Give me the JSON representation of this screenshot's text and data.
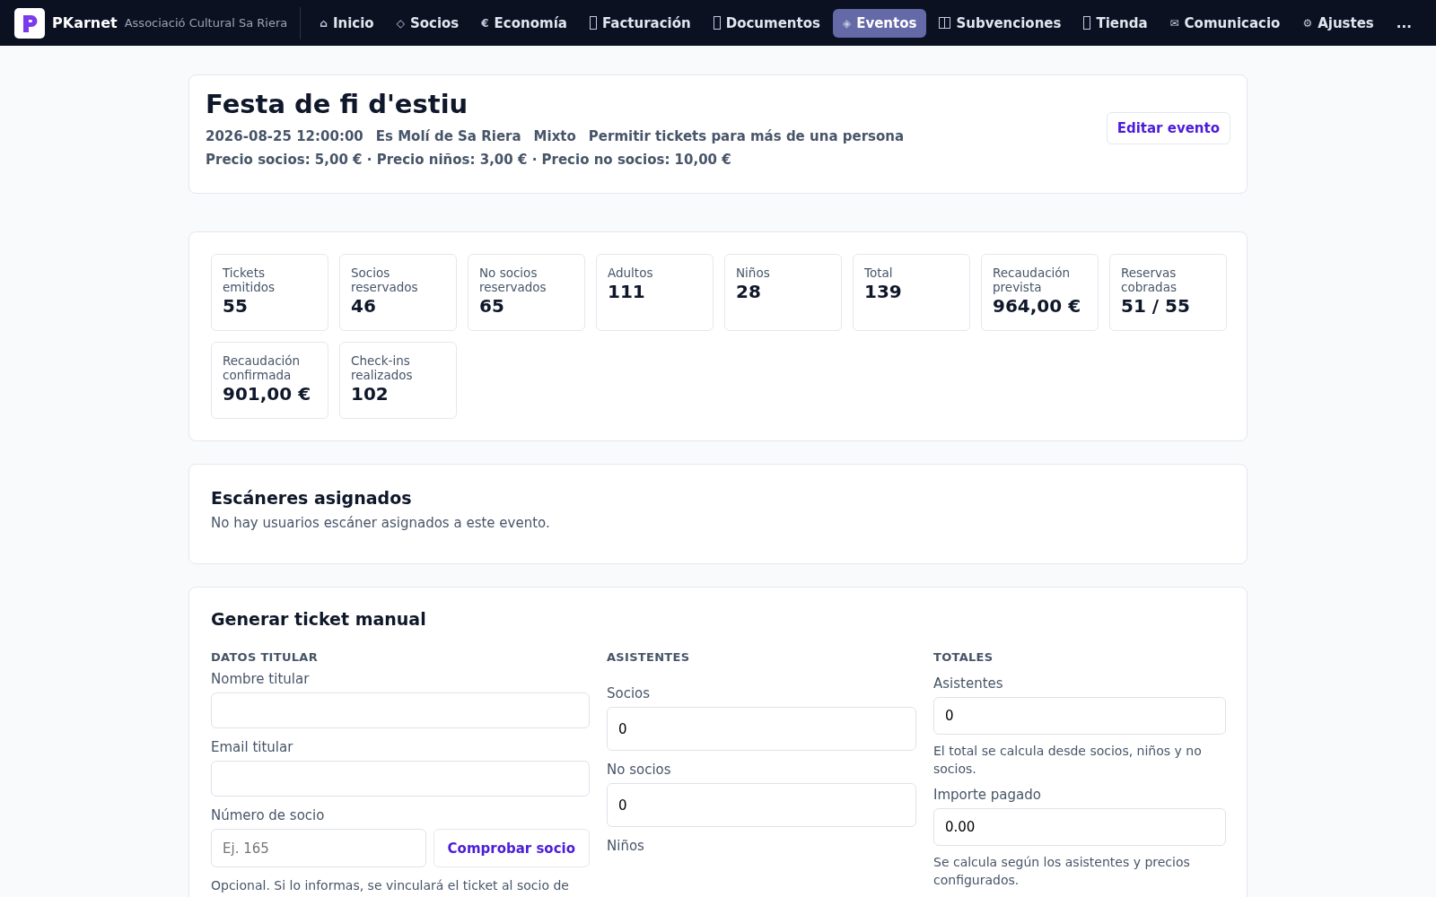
{
  "brand": {
    "name": "PKarnet",
    "subtitle": "Associació Cultural Sa Riera"
  },
  "nav": [
    {
      "label": "Inicio",
      "icon": "⌂",
      "selected": false
    },
    {
      "label": "Socios",
      "icon": "◇",
      "selected": false
    },
    {
      "label": "Economía",
      "icon": "€",
      "selected": false
    },
    {
      "label": "Facturación",
      "kind": "box",
      "selected": false
    },
    {
      "label": "Documentos",
      "kind": "box",
      "selected": false
    },
    {
      "label": "Eventos",
      "icon": "◈",
      "selected": true
    },
    {
      "label": "Subvenciones",
      "kind": "split",
      "selected": false
    },
    {
      "label": "Tienda",
      "kind": "box",
      "selected": false
    },
    {
      "label": "Comunicacio",
      "icon": "✉",
      "selected": false
    },
    {
      "label": "Ajustes",
      "icon": "⚙",
      "selected": false
    }
  ],
  "nav_more": "...",
  "event": {
    "title": "Festa de fi d'estiu",
    "meta": [
      "2026-08-25 12:00:00",
      "Es Molí de Sa Riera",
      "Mixto",
      "Permitir tickets para más de una persona"
    ],
    "prices": "Precio socios: 5,00 € · Precio niños: 3,00 € · Precio no socios: 10,00 €",
    "edit_button": "Editar evento"
  },
  "stats": [
    {
      "label": "Tickets emitidos",
      "value": "55"
    },
    {
      "label": "Socios reservados",
      "value": "46"
    },
    {
      "label": "No socios reservados",
      "value": "65"
    },
    {
      "label": "Adultos",
      "value": "111"
    },
    {
      "label": "Niños",
      "value": "28"
    },
    {
      "label": "Total",
      "value": "139"
    },
    {
      "label": "Recaudación prevista",
      "value": "964,00 €"
    },
    {
      "label": "Reservas cobradas",
      "value": "51 / 55"
    },
    {
      "label": "Recaudación confirmada",
      "value": "901,00 €"
    },
    {
      "label": "Check-ins realizados",
      "value": "102"
    }
  ],
  "scanners": {
    "title": "Escáneres asignados",
    "empty": "No hay usuarios escáner asignados a este evento."
  },
  "manual_ticket": {
    "title": "Generar ticket manual",
    "holder": {
      "heading": "DATOS TITULAR",
      "fields": [
        {
          "label": "Nombre titular"
        },
        {
          "label": "Email titular"
        }
      ],
      "member_label": "Número de socio",
      "member_placeholder": "Ej. 165",
      "check_button": "Comprobar socio",
      "hint": "Opcional. Si lo informas, se vinculará el ticket al socio de"
    },
    "attendees": {
      "heading": "ASISTENTES",
      "fields": [
        {
          "label": "Socios",
          "value": "0"
        },
        {
          "label": "No socios",
          "value": "0"
        }
      ],
      "next_label": "Niños"
    },
    "totals": {
      "heading": "TOTALES",
      "fields": [
        {
          "label": "Asistentes",
          "value": "0",
          "hint": "El total se calcula desde socios, niños y no socios."
        },
        {
          "label": "Importe pagado",
          "value": "0.00",
          "hint": "Se calcula según los asistentes y precios configurados."
        }
      ]
    }
  }
}
